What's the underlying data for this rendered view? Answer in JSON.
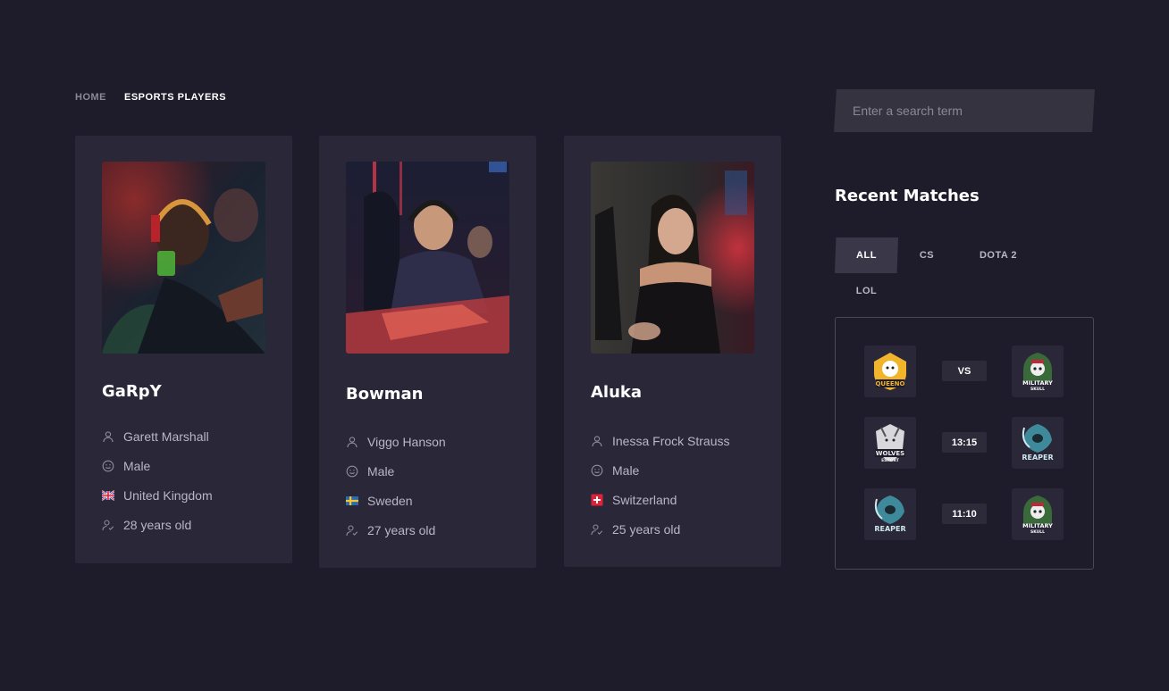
{
  "breadcrumb": {
    "home": "HOME",
    "current": "ESPORTS PLAYERS"
  },
  "players": [
    {
      "nick": "GaRpY",
      "name": "Garett Marshall",
      "gender": "Male",
      "country": "United Kingdom",
      "flag": "uk-flag",
      "age": "28 years old"
    },
    {
      "nick": "Bowman",
      "name": "Viggo Hanson",
      "gender": "Male",
      "country": "Sweden",
      "flag": "sweden-flag",
      "age": "27 years old"
    },
    {
      "nick": "Aluka",
      "name": "Inessa Frock Strauss",
      "gender": "Male",
      "country": "Switzerland",
      "flag": "switzerland-flag",
      "age": "25 years old"
    }
  ],
  "search": {
    "placeholder": "Enter a search term"
  },
  "recent": {
    "title": "Recent Matches",
    "tabs": [
      "ALL",
      "CS",
      "DOTA 2",
      "LOL"
    ],
    "active_tab": "ALL",
    "matches": [
      {
        "team1": "QUEENO",
        "team2": "MILITARY SKULL",
        "result": "VS"
      },
      {
        "team1": "WOLVES ESPORT",
        "team2": "REAPER",
        "result": "13:15"
      },
      {
        "team1": "REAPER",
        "team2": "MILITARY SKULL",
        "result": "11:10"
      }
    ]
  },
  "colors": {
    "background": "#1e1c2a",
    "card": "#292738",
    "accent_text": "#ffffff"
  }
}
